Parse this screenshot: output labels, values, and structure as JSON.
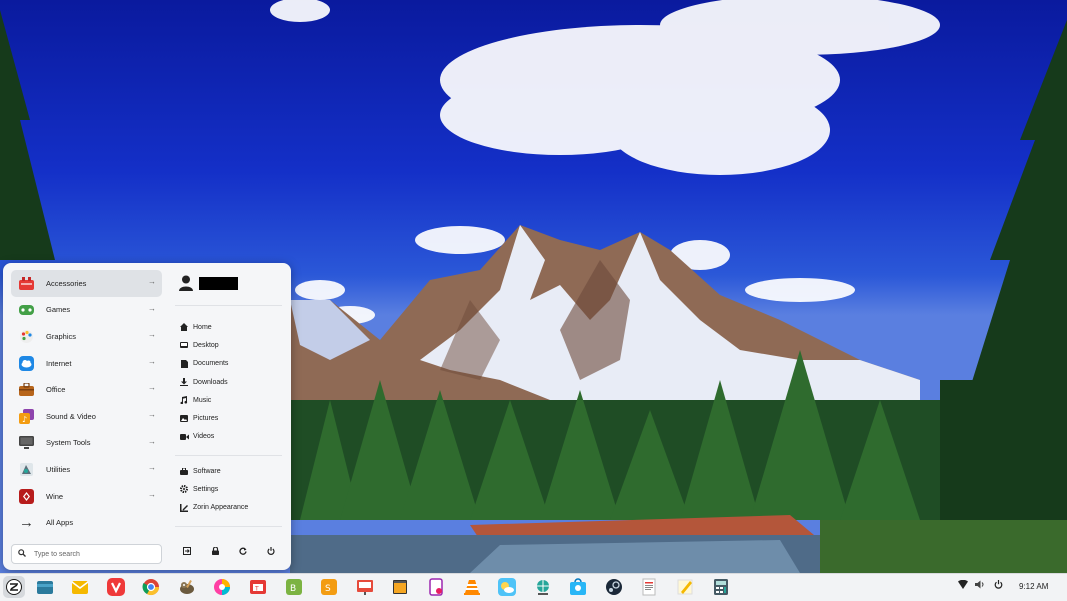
{
  "menu": {
    "categories": [
      {
        "label": "Accessories",
        "icon": "accessories-icon",
        "color": "#e53935"
      },
      {
        "label": "Games",
        "icon": "games-icon",
        "color": "#43a047"
      },
      {
        "label": "Graphics",
        "icon": "graphics-icon",
        "color": "#ffffff"
      },
      {
        "label": "Internet",
        "icon": "internet-icon",
        "color": "#1e88e5"
      },
      {
        "label": "Office",
        "icon": "office-icon",
        "color": "#b7651b"
      },
      {
        "label": "Sound & Video",
        "icon": "sound-video-icon",
        "color": "#8e44ad"
      },
      {
        "label": "System Tools",
        "icon": "system-tools-icon",
        "color": "#444444"
      },
      {
        "label": "Utilities",
        "icon": "utilities-icon",
        "color": "#5a6f7a"
      },
      {
        "label": "Wine",
        "icon": "wine-icon",
        "color": "#b71c1c"
      }
    ],
    "active_category": "Accessories",
    "all_apps_label": "All Apps",
    "search_placeholder": "Type to search",
    "places": [
      {
        "label": "Home",
        "icon": "home-icon"
      },
      {
        "label": "Desktop",
        "icon": "desktop-icon"
      },
      {
        "label": "Documents",
        "icon": "documents-icon"
      },
      {
        "label": "Downloads",
        "icon": "downloads-icon"
      },
      {
        "label": "Music",
        "icon": "music-icon"
      },
      {
        "label": "Pictures",
        "icon": "pictures-icon"
      },
      {
        "label": "Videos",
        "icon": "videos-icon"
      }
    ],
    "system": [
      {
        "label": "Software",
        "icon": "software-icon"
      },
      {
        "label": "Settings",
        "icon": "settings-icon"
      },
      {
        "label": "Zorin Appearance",
        "icon": "appearance-icon"
      }
    ],
    "power_buttons": [
      "log-out-icon",
      "lock-icon",
      "restart-icon",
      "power-icon"
    ]
  },
  "taskbar": {
    "apps": [
      "zorin-menu-icon",
      "files-icon",
      "mail-icon",
      "vivaldi-icon",
      "chrome-icon",
      "gimp-icon",
      "color-picker-icon",
      "tasks-icon",
      "ebook-icon",
      "office-suite-icon",
      "presentation-icon",
      "archive-icon",
      "screen-recorder-icon",
      "vlc-icon",
      "weather-icon",
      "maps-icon",
      "store-icon",
      "steam-icon",
      "document-viewer-icon",
      "text-editor-icon",
      "calculator-icon"
    ],
    "tray": [
      "wifi-icon",
      "volume-icon",
      "power-icon"
    ],
    "clock": "9:12 AM"
  }
}
